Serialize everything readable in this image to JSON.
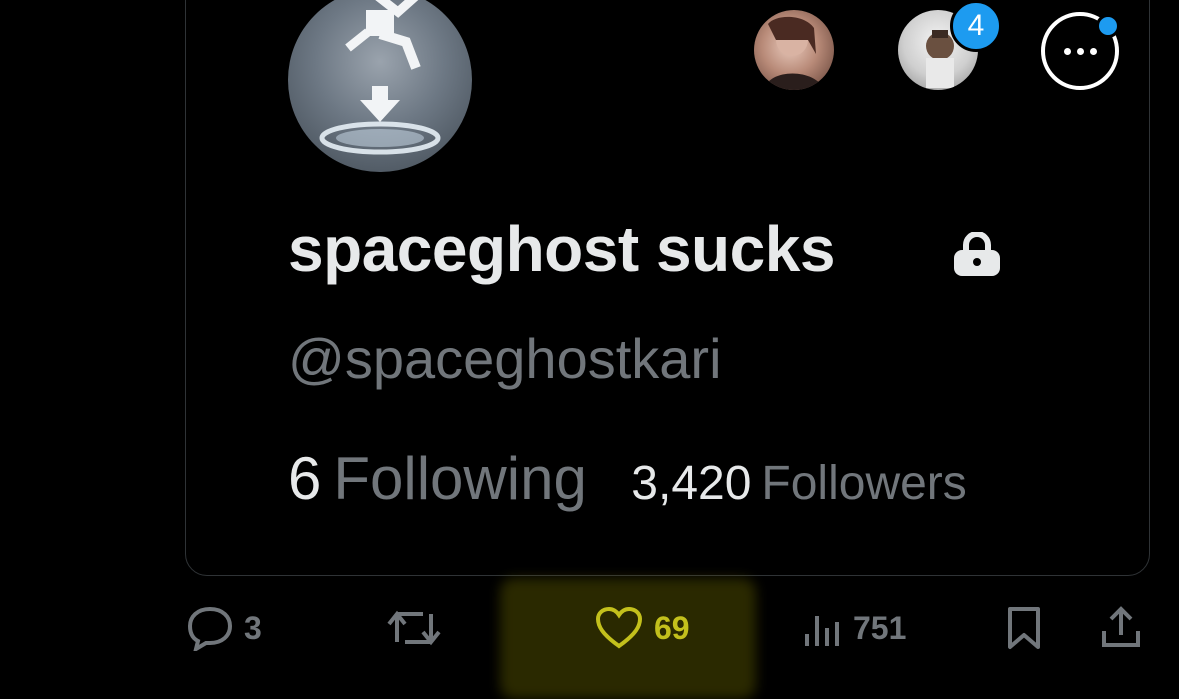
{
  "profile": {
    "display_name": "spaceghost sucks",
    "handle": "@spaceghostkari",
    "protected": true
  },
  "header": {
    "notification_count": "4"
  },
  "stats": {
    "following_count": "6",
    "following_label": "Following",
    "followers_count": "3,420",
    "followers_label": "Followers"
  },
  "actions": {
    "reply_count": "3",
    "retweet_count": "",
    "like_count": "69",
    "views_count": "751"
  },
  "colors": {
    "accent": "#1d9bf0",
    "like_highlight": "#c3c01c",
    "text_primary": "#e7e9ea",
    "text_secondary": "#71767b"
  }
}
